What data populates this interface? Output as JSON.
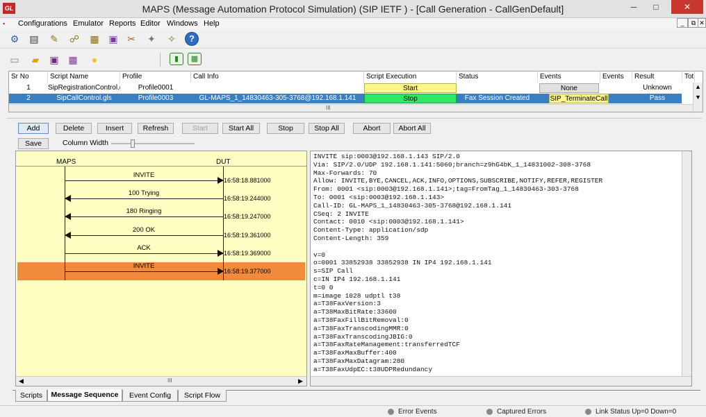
{
  "window": {
    "title": "MAPS (Message Automation Protocol Simulation)  (SIP IETF ) - [Call Generation  - CallGenDefault]",
    "logo": "GL",
    "min_label": "─",
    "max_label": "□",
    "close_label": "✕"
  },
  "menu": {
    "items": [
      "Configurations",
      "Emulator",
      "Reports",
      "Editor",
      "Windows",
      "Help"
    ],
    "mdi": [
      "_",
      "⧉",
      "✕"
    ]
  },
  "toolbar1": {
    "icons": [
      "gear-icon",
      "notepad-icon",
      "db-icon",
      "network-icon",
      "profiles-icon",
      "briefcase-icon",
      "tools-icon",
      "wizard-icon",
      "help-icon"
    ],
    "glyphs": [
      "⚙",
      "▤",
      "✎",
      "☍",
      "▦",
      "▣",
      "✂",
      "✦",
      "?"
    ]
  },
  "toolbar2": {
    "icons": [
      "new-file-icon",
      "open-folder-icon",
      "save-icon",
      "save-as-icon",
      "bulb-icon",
      "single-tree-icon",
      "multi-tree-icon"
    ],
    "glyphs": [
      "▭",
      "▰",
      "▣",
      "▦",
      "●",
      "▮",
      "▩"
    ]
  },
  "grid": {
    "headers": [
      "Sr No",
      "Script Name",
      "Profile",
      "Call Info",
      "Script Execution",
      "Status",
      "Events",
      "Events",
      "Result",
      "Tot"
    ],
    "rows": [
      {
        "sr": "1",
        "script": "SipRegistrationControl.gls",
        "profile": "Profile0001",
        "callinfo": "",
        "exec": "Start",
        "status": "",
        "events": "None",
        "events2": "",
        "result": "Unknown"
      },
      {
        "sr": "2",
        "script": "SipCallControl.gls",
        "profile": "Profile0003",
        "callinfo": "GL-MAPS_1_14830463-305-3768@192.168.1.141",
        "exec": "Stop",
        "status": "Fax Session Created",
        "events": "SIP_TerminateCall",
        "events2": "",
        "result": "Pass"
      }
    ],
    "scroll_mark": "III"
  },
  "actions": [
    "Add",
    "Delete",
    "Insert",
    "Refresh",
    "Start",
    "Start All",
    "Stop",
    "Stop All",
    "Abort",
    "Abort All"
  ],
  "view_controls": {
    "save": "Save",
    "column_width": "Column Width"
  },
  "ladder": {
    "left_entity": "MAPS",
    "right_entity": "DUT",
    "messages": [
      {
        "label": "INVITE",
        "time": "16:58:18.881000",
        "dir": "right",
        "highlight": false
      },
      {
        "label": "100  Trying",
        "time": "16:58:19.244000",
        "dir": "left",
        "highlight": false
      },
      {
        "label": "180  Ringing",
        "time": "16:58:19.247000",
        "dir": "left",
        "highlight": false
      },
      {
        "label": "200  OK",
        "time": "16:58:19.361000",
        "dir": "left",
        "highlight": false
      },
      {
        "label": "ACK",
        "time": "16:58:19.369000",
        "dir": "right",
        "highlight": false
      },
      {
        "label": "INVITE",
        "time": "16:58:19.377000",
        "dir": "right",
        "highlight": true
      }
    ],
    "scroll_mark": "III"
  },
  "message_lines": [
    "INVITE sip:0003@192.168.1.143 SIP/2.0",
    "Via: SIP/2.0/UDP 192.168.1.141:5060;branch=z9hG4bK_1_14831002-308-3768",
    "Max-Forwards: 70",
    "Allow: INVITE,BYE,CANCEL,ACK,INFO,OPTIONS,SUBSCRIBE,NOTIFY,REFER,REGISTER",
    "From: 0001 <sip:0003@192.168.1.141>;tag=FromTag_1_14830463-303-3768",
    "To: 0001 <sip:0003@192.168.1.143>",
    "Call-ID: GL-MAPS_1_14830463-305-3768@192.168.1.141",
    "CSeq: 2 INVITE",
    "Contact: 0010 <sip:0003@192.168.1.141>",
    "Content-Type: application/sdp",
    "Content-Length: 359",
    "",
    "v=0",
    "o=0001 33852938 33852938 IN IP4 192.168.1.141",
    "s=SIP Call",
    "c=IN IP4 192.168.1.141",
    "t=0 0",
    "m=image 1028 udptl t38",
    "a=T38FaxVersion:3",
    "a=T38MaxBitRate:33600",
    "a=T38FaxFillBitRemoval:0",
    "a=T38FaxTranscodingMMR:0",
    "a=T38FaxTranscodingJBIG:0",
    "a=T38FaxRateManagement:transferredTCF",
    "a=T38FaxMaxBuffer:400",
    "a=T38FaxMaxDatagram:280",
    "a=T38FaxUdpEC:t38UDPRedundancy"
  ],
  "tabs": [
    "Scripts",
    "Message Sequence",
    "Event Config",
    "Script Flow"
  ],
  "status": {
    "error_events": "Error Events",
    "captured_errors": "Captured Errors",
    "link_status": "Link Status Up=0 Down=0"
  },
  "colors": {
    "start_yellow": "#fbf68a",
    "stop_green": "#2ee866",
    "selected_row": "#3d7ebf",
    "highlight_orange": "#f08a3c",
    "ladder_bg": "#ffffc4"
  }
}
